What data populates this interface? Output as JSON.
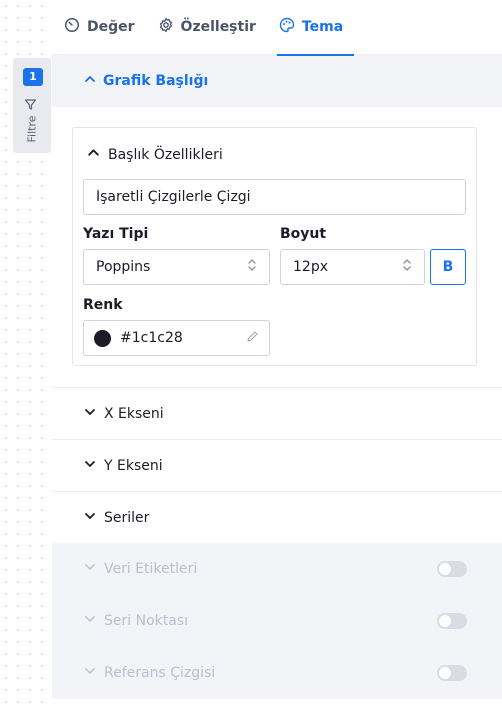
{
  "filter": {
    "badge": "1",
    "label": "Filtre"
  },
  "tabs": [
    {
      "label": "Değer",
      "icon": "gauge-icon",
      "active": false
    },
    {
      "label": "Özelleştir",
      "icon": "gear-icon",
      "active": false
    },
    {
      "label": "Tema",
      "icon": "palette-icon",
      "active": true
    }
  ],
  "section": {
    "title": "Grafik Başlığı"
  },
  "title_props": {
    "header": "Başlık Özellikleri",
    "title_value": "İşaretli Çizgilerle Çizgi",
    "font_label": "Yazı Tipi",
    "font_value": "Poppins",
    "size_label": "Boyut",
    "size_value": "12px",
    "bold_label": "B",
    "color_label": "Renk",
    "color_value": "#1c1c28",
    "color_text": "#1c1c28"
  },
  "accordions": [
    {
      "label": "X Ekseni"
    },
    {
      "label": "Y Ekseni"
    },
    {
      "label": "Seriler"
    }
  ],
  "disabled_accordions": [
    {
      "label": "Veri Etiketleri",
      "toggle": false
    },
    {
      "label": "Seri Noktası",
      "toggle": false
    },
    {
      "label": "Referans Çizgisi",
      "toggle": false
    }
  ],
  "colors": {
    "accent": "#1a73e8",
    "text": "#1c1c28",
    "disabled": "#b9bfcc"
  }
}
